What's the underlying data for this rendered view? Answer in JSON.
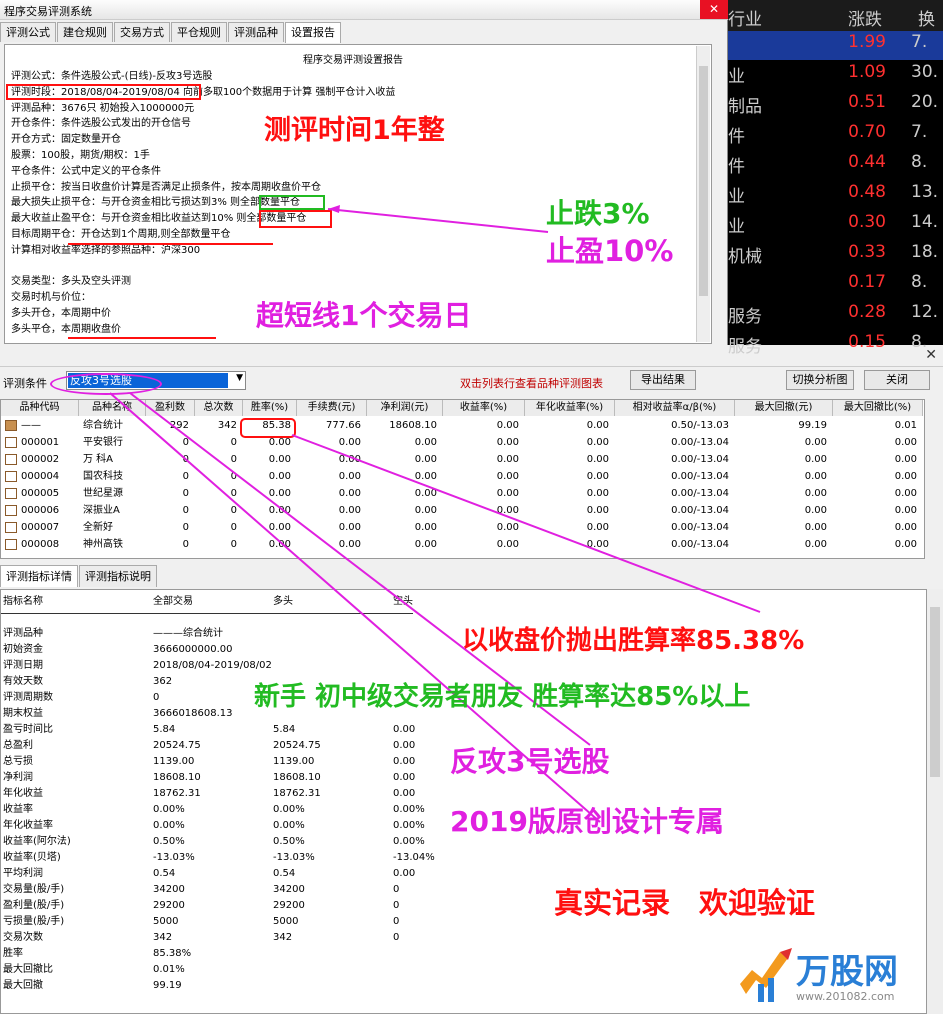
{
  "top_window": {
    "title": "程序交易评测系统",
    "close": "✕",
    "tabs": [
      "评测公式",
      "建仓规则",
      "交易方式",
      "平仓规则",
      "评测品种",
      "设置报告"
    ],
    "report_title": "程序交易评测设置报告",
    "lines": [
      "评测公式：条件选股公式-(日线)-反攻3号选股",
      "评测时段：2018/08/04-2019/08/04 向前多取100个数据用于计算 强制平仓计入收益",
      "评测品种：3676只 初始投入1000000元",
      "开仓条件：条件选股公式发出的开仓信号",
      "开仓方式：固定数量开仓",
      "        股票：100股，期货/期权：1手",
      "平仓条件：公式中定义的平仓条件",
      "止损平仓：按当日收盘价计算是否满足止损条件，按本周期收盘价平仓",
      "        最大损失止损平仓：与开仓资金相比亏损达到3% 则全部数量平仓",
      "        最大收益止盈平仓：与开仓资金相比收益达到10% 则全部数量平仓",
      "        目标周期平仓：开仓达到1个周期,则全部数量平仓",
      "        计算相对收益率选择的参照品种：沪深300",
      "",
      "交易类型：多头及空头评测",
      "交易时机与价位：",
      "        多头开仓，本周期中价",
      "        多头平仓，本周期收盘价"
    ]
  },
  "stock_list": {
    "headers": [
      "行业",
      "涨跌",
      "换"
    ],
    "rows": [
      {
        "name": "",
        "change": "1.99",
        "turnover": "7."
      },
      {
        "name": "业",
        "change": "1.09",
        "turnover": "30."
      },
      {
        "name": "制品",
        "change": "0.51",
        "turnover": "20."
      },
      {
        "name": "件",
        "change": "0.70",
        "turnover": "7."
      },
      {
        "name": "件",
        "change": "0.44",
        "turnover": "8."
      },
      {
        "name": "业",
        "change": "0.48",
        "turnover": "13."
      },
      {
        "name": "业",
        "change": "0.30",
        "turnover": "14."
      },
      {
        "name": "机械",
        "change": "0.33",
        "turnover": "18."
      },
      {
        "name": "",
        "change": "0.17",
        "turnover": "8."
      },
      {
        "name": "服务",
        "change": "0.28",
        "turnover": "12."
      },
      {
        "name": "服务",
        "change": "0.15",
        "turnover": "8."
      }
    ]
  },
  "bottom_window": {
    "close": "✕",
    "cond_label": "评测条件",
    "cond_value": "反攻3号选股",
    "hint": "双击列表行查看品种评测图表",
    "btn_export": "导出结果",
    "btn_switch": "切换分析图",
    "btn_close": "关闭",
    "columns": [
      "品种代码",
      "品种名称",
      "盈利数",
      "总次数",
      "胜率(%)",
      "手续费(元)",
      "净利润(元)",
      "收益率(%)",
      "年化收益率(%)",
      "相对收益率α/β(%)",
      "最大回撤(元)",
      "最大回撤比(%)"
    ],
    "rows": [
      [
        "——",
        "综合统计",
        "292",
        "342",
        "85.38",
        "777.66",
        "18608.10",
        "0.00",
        "0.00",
        "0.50/-13.03",
        "99.19",
        "0.01"
      ],
      [
        "000001",
        "平安银行",
        "0",
        "0",
        "0.00",
        "0.00",
        "0.00",
        "0.00",
        "0.00",
        "0.00/-13.04",
        "0.00",
        "0.00"
      ],
      [
        "000002",
        "万 科A",
        "0",
        "0",
        "0.00",
        "0.00",
        "0.00",
        "0.00",
        "0.00",
        "0.00/-13.04",
        "0.00",
        "0.00"
      ],
      [
        "000004",
        "国农科技",
        "0",
        "0",
        "0.00",
        "0.00",
        "0.00",
        "0.00",
        "0.00",
        "0.00/-13.04",
        "0.00",
        "0.00"
      ],
      [
        "000005",
        "世纪星源",
        "0",
        "0",
        "0.00",
        "0.00",
        "0.00",
        "0.00",
        "0.00",
        "0.00/-13.04",
        "0.00",
        "0.00"
      ],
      [
        "000006",
        "深振业A",
        "0",
        "0",
        "0.00",
        "0.00",
        "0.00",
        "0.00",
        "0.00",
        "0.00/-13.04",
        "0.00",
        "0.00"
      ],
      [
        "000007",
        "全新好",
        "0",
        "0",
        "0.00",
        "0.00",
        "0.00",
        "0.00",
        "0.00",
        "0.00/-13.04",
        "0.00",
        "0.00"
      ],
      [
        "000008",
        "神州高铁",
        "0",
        "0",
        "0.00",
        "0.00",
        "0.00",
        "0.00",
        "0.00",
        "0.00/-13.04",
        "0.00",
        "0.00"
      ]
    ],
    "detail_tabs": [
      "评测指标详情",
      "评测指标说明"
    ],
    "detail_headers": [
      "指标名称",
      "全部交易",
      "多头",
      "空头"
    ],
    "detail_rows": [
      [
        "评测品种",
        "———综合统计",
        "",
        ""
      ],
      [
        "初始资金",
        "3666000000.00",
        "",
        ""
      ],
      [
        "评测日期",
        "2018/08/04-2019/08/02",
        "",
        ""
      ],
      [
        "有效天数",
        "362",
        "",
        ""
      ],
      [
        "评测周期数",
        "0",
        "",
        ""
      ],
      [
        "期末权益",
        "3666018608.13",
        "",
        ""
      ],
      [
        "盈亏时间比",
        "5.84",
        "5.84",
        "0.00"
      ],
      [
        "总盈利",
        "20524.75",
        "20524.75",
        "0.00"
      ],
      [
        "总亏损",
        "1139.00",
        "1139.00",
        "0.00"
      ],
      [
        "净利润",
        "18608.10",
        "18608.10",
        "0.00"
      ],
      [
        "年化收益",
        "18762.31",
        "18762.31",
        "0.00"
      ],
      [
        "收益率",
        "0.00%",
        "0.00%",
        "0.00%"
      ],
      [
        "年化收益率",
        "0.00%",
        "0.00%",
        "0.00%"
      ],
      [
        "收益率(阿尔法)",
        "0.50%",
        "0.50%",
        "0.00%"
      ],
      [
        "收益率(贝塔)",
        "-13.03%",
        "-13.03%",
        "-13.04%"
      ],
      [
        "平均利润",
        "0.54",
        "0.54",
        "0.00"
      ],
      [
        "交易量(股/手)",
        "34200",
        "34200",
        "0"
      ],
      [
        "盈利量(股/手)",
        "29200",
        "29200",
        "0"
      ],
      [
        "亏损量(股/手)",
        "5000",
        "5000",
        "0"
      ],
      [
        "交易次数",
        "342",
        "342",
        "0"
      ],
      [
        "胜率",
        "85.38%",
        "",
        ""
      ],
      [
        "最大回撤比",
        "0.01%",
        "",
        ""
      ],
      [
        "最大回撤",
        "99.19",
        "",
        ""
      ]
    ]
  },
  "annotations": {
    "a1": "测评时间1年整",
    "a2": "止跌3%",
    "a3": "止盈10%",
    "a4": "超短线1个交易日",
    "a5": "以收盘价抛出胜算率85.38%",
    "a6": "新手 初中级交易者朋友 胜算率达85%以上",
    "a7": "反攻3号选股",
    "a8": "2019版原创设计专属",
    "a9": "真实记录　欢迎验证",
    "logo": "万股网",
    "logo_url": "www.201082.com"
  },
  "colors": {
    "red": "#ff1010",
    "magenta": "#e020e0",
    "green": "#22bb22",
    "selected": "#0a64d8"
  }
}
